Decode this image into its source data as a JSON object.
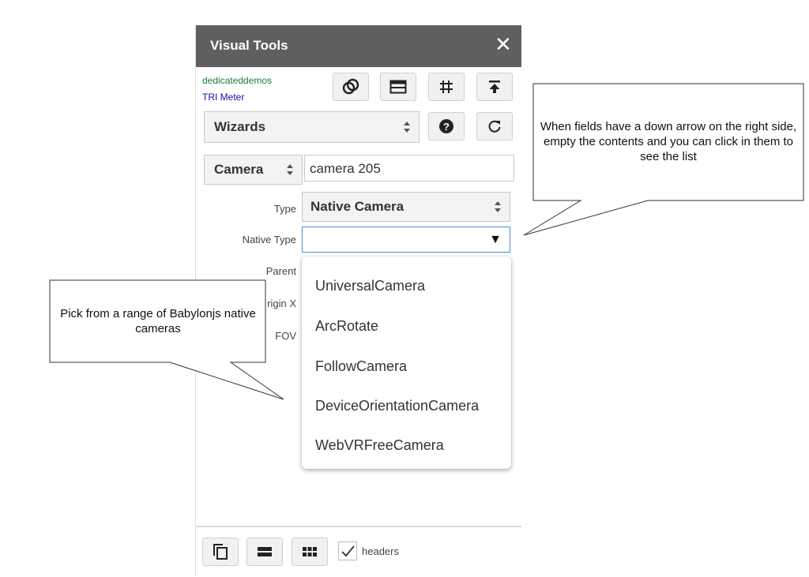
{
  "panel": {
    "title": "Visual Tools",
    "close_icon": "✕",
    "links": {
      "account": "dedicateddemos",
      "app": "TRI Meter"
    },
    "wizard_select": "Wizards",
    "entity_select": "Camera",
    "entity_name": "camera 205"
  },
  "form": {
    "type_label": "Type",
    "type_value": "Native Camera",
    "native_type_label": "Native Type",
    "native_type_value": "",
    "native_type_arrow": "▼",
    "parent_label": "Parent",
    "origin_label": "rigin X",
    "fov_label": "FOV"
  },
  "dropdown": {
    "options": [
      "UniversalCamera",
      "ArcRotate",
      "FollowCamera",
      "DeviceOrientationCamera",
      "WebVRFreeCamera"
    ]
  },
  "footer": {
    "headers_label": "headers",
    "headers_checked": true
  },
  "callouts": {
    "right": "When fields have a down arrow on the right side, empty the contents and you can click in them to see the list",
    "left": "Pick from a range of Babylonjs native cameras"
  },
  "colors": {
    "titlebar": "#5f5f5f",
    "link_green": "#188038",
    "link_blue": "#1a0dab",
    "focus_border": "#4a90e2"
  }
}
